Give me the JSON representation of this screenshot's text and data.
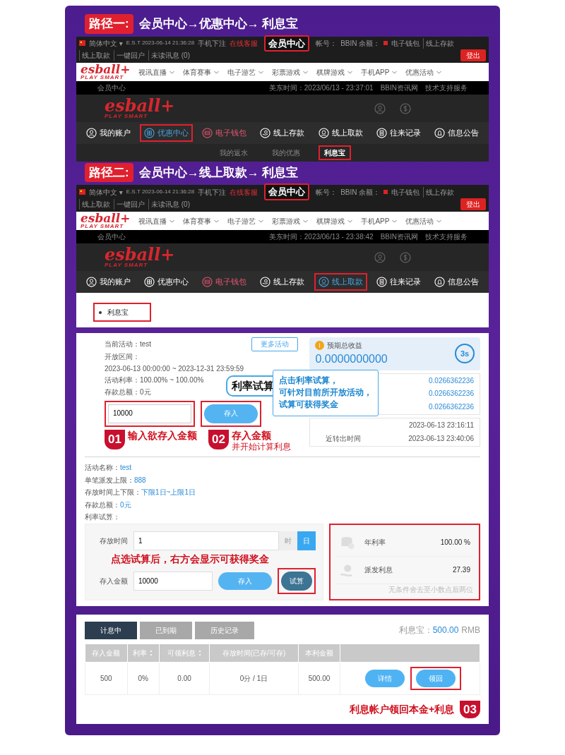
{
  "paths": [
    {
      "badge": "路径一:",
      "title": "会员中心→优惠中心→ 利息宝",
      "screen": {
        "lang": "简体中文 ▾",
        "clock": "E.S.T 2023-06-14 21:36:28",
        "top_links": [
          {
            "label": "手机下注",
            "kind": "plain"
          },
          {
            "label": "在线客服",
            "kind": "alert"
          }
        ],
        "callout": "会员中心",
        "account_fields": [
          "帐号：",
          "BBIN 余额："
        ],
        "quick_links": [
          "电子钱包",
          "线上存款",
          "线上取款",
          "一键回户",
          "未读讯息 (0)"
        ],
        "logout": "登出",
        "menu_logo": {
          "name": "esball+",
          "tagline": "PLAY SMART"
        },
        "menu": [
          "视讯直播",
          "体育赛事",
          "电子游艺",
          "彩票游戏",
          "棋牌游戏",
          "手机APP",
          "优惠活动"
        ],
        "breadcrumb": "会员中心",
        "time": "美东时间：2023/06/13 - 23:37:01",
        "info_links": [
          "BBIN资讯网",
          "技术支持服务"
        ],
        "header_logo": {
          "name": "esball+",
          "tagline": "PLAY SMART"
        },
        "member_nav": [
          {
            "label": "我的账户",
            "selected": false,
            "boxed": false,
            "kind": "normal"
          },
          {
            "label": "优惠中心",
            "selected": true,
            "boxed": true,
            "kind": "normal"
          },
          {
            "label": "电子钱包",
            "selected": false,
            "boxed": false,
            "kind": "wallet"
          },
          {
            "label": "线上存款",
            "selected": false,
            "boxed": false,
            "kind": "normal"
          },
          {
            "label": "线上取款",
            "selected": false,
            "boxed": false,
            "kind": "normal"
          },
          {
            "label": "往来记录",
            "selected": false,
            "boxed": false,
            "kind": "normal"
          },
          {
            "label": "信息公告",
            "selected": false,
            "boxed": false,
            "kind": "normal"
          }
        ],
        "sub_nav": [
          {
            "label": "我的返水",
            "selected": false,
            "boxed": false
          },
          {
            "label": "我的优惠",
            "selected": false,
            "boxed": false
          },
          {
            "label": "利息宝",
            "selected": true,
            "boxed": true
          }
        ]
      }
    },
    {
      "badge": "路径二:",
      "title": "会员中心→线上取款→ 利息宝",
      "screen": {
        "lang": "简体中文 ▾",
        "clock": "E.S.T 2023-06-14 21:36:28",
        "top_links": [
          {
            "label": "手机下注",
            "kind": "plain"
          },
          {
            "label": "在线客服",
            "kind": "alert"
          }
        ],
        "callout": "会员中心",
        "account_fields": [
          "帐号：",
          "BBIN 余额："
        ],
        "quick_links": [
          "电子钱包",
          "线上存款",
          "线上取款",
          "一键回户",
          "未读讯息 (0)"
        ],
        "logout": "登出",
        "menu_logo": {
          "name": "esball+",
          "tagline": "PLAY SMART"
        },
        "menu": [
          "视讯直播",
          "体育赛事",
          "电子游艺",
          "彩票游戏",
          "棋牌游戏",
          "手机APP",
          "优惠活动"
        ],
        "breadcrumb": "会员中心",
        "time": "美东时间：2023/06/13 - 23:38:42",
        "info_links": [
          "BBIN资讯网",
          "技术支持服务"
        ],
        "header_logo": {
          "name": "esball+",
          "tagline": "PLAY SMART"
        },
        "member_nav": [
          {
            "label": "我的账户",
            "selected": false,
            "boxed": false,
            "kind": "normal"
          },
          {
            "label": "优惠中心",
            "selected": false,
            "boxed": false,
            "kind": "normal"
          },
          {
            "label": "电子钱包",
            "selected": false,
            "boxed": false,
            "kind": "wallet"
          },
          {
            "label": "线上存款",
            "selected": false,
            "boxed": false,
            "kind": "normal"
          },
          {
            "label": "线上取款",
            "selected": true,
            "boxed": true,
            "kind": "normal"
          },
          {
            "label": "往来记录",
            "selected": false,
            "boxed": false,
            "kind": "normal"
          },
          {
            "label": "信息公告",
            "selected": false,
            "boxed": false,
            "kind": "normal"
          }
        ],
        "link_list": [
          {
            "label": "利息宝",
            "boxed": true
          }
        ]
      }
    }
  ],
  "activity": {
    "current_label": "当前活动：",
    "current": "test",
    "more_button": "更多活动",
    "period_label": "开放区间：",
    "period": "2023-06-13 00:00:00 ~ 2023-12-31 23:59:59",
    "rate": "活动利率：100.00% ~ 100.00%",
    "total": "存款总额：0元",
    "amount": "10000",
    "deposit_button": "存入",
    "earnings": {
      "label": "预期总收益",
      "value": "0.0000000000",
      "countdown": "3s"
    },
    "rows": [
      "0.0266362236",
      "0.0266362236",
      "0.0266362236"
    ],
    "times": [
      {
        "value": "2023-06-13 23:16:11"
      },
      {
        "label": "近转出时间",
        "value": "2023-06-13 23:40:06"
      }
    ],
    "tip": {
      "tag": "利率试算",
      "lines": [
        "点击利率试算，",
        "可针对目前所开放活动，",
        "试算可获得奖金"
      ]
    },
    "steps": [
      {
        "number": "01",
        "text": "输入欲存入金额"
      },
      {
        "number": "02",
        "text": "存入金额",
        "note": "并开始计算利息"
      }
    ]
  },
  "details": [
    {
      "label": "活动名称：",
      "value": "test"
    },
    {
      "label": "单笔派发上限：",
      "value": "888"
    },
    {
      "label": "存放时间上下限：",
      "value": "下限1日~上限1日"
    },
    {
      "label": "存款总额：",
      "value": "0元"
    },
    {
      "label": "利率试算："
    }
  ],
  "calculator": {
    "duration_label": "存放时间",
    "duration": "1",
    "units": [
      {
        "label": "时",
        "selected": false
      },
      {
        "label": "日",
        "selected": true
      }
    ],
    "hint": "点选试算后，右方会显示可获得奖金",
    "amount_label": "存入金额",
    "amount": "10000",
    "deposit_button": "存入",
    "trial_button": "试算"
  },
  "results": [
    {
      "label": "年利率",
      "value": "100.00 %"
    },
    {
      "label": "派发利息",
      "value": "27.39"
    }
  ],
  "results_note": "无条件舍去至小数点后两位",
  "interest": {
    "tabs": [
      {
        "label": "计息中",
        "selected": true
      },
      {
        "label": "已到期",
        "selected": false
      },
      {
        "label": "历史记录",
        "selected": false
      }
    ],
    "balance": {
      "label": "利息宝：",
      "value": "500.00",
      "unit": "RMB"
    },
    "table": {
      "columns": [
        {
          "label": "存入金额",
          "sortable": false
        },
        {
          "label": "利率",
          "sortable": true
        },
        {
          "label": "可领利息",
          "sortable": true
        },
        {
          "label": "存放时间(已存/可存)",
          "sortable": false
        },
        {
          "label": "本利金额",
          "sortable": false
        },
        {
          "sortable": false
        }
      ],
      "rows": [
        {
          "cells": [
            "500",
            "0%",
            "0.00",
            "0分 / 1日",
            "500.00"
          ],
          "actions": [
            {
              "label": "详情",
              "boxed": false
            },
            {
              "label": "领回",
              "boxed": true
            }
          ]
        }
      ]
    },
    "step": {
      "number": "03",
      "text": "利息帐户领回本金+利息"
    }
  }
}
